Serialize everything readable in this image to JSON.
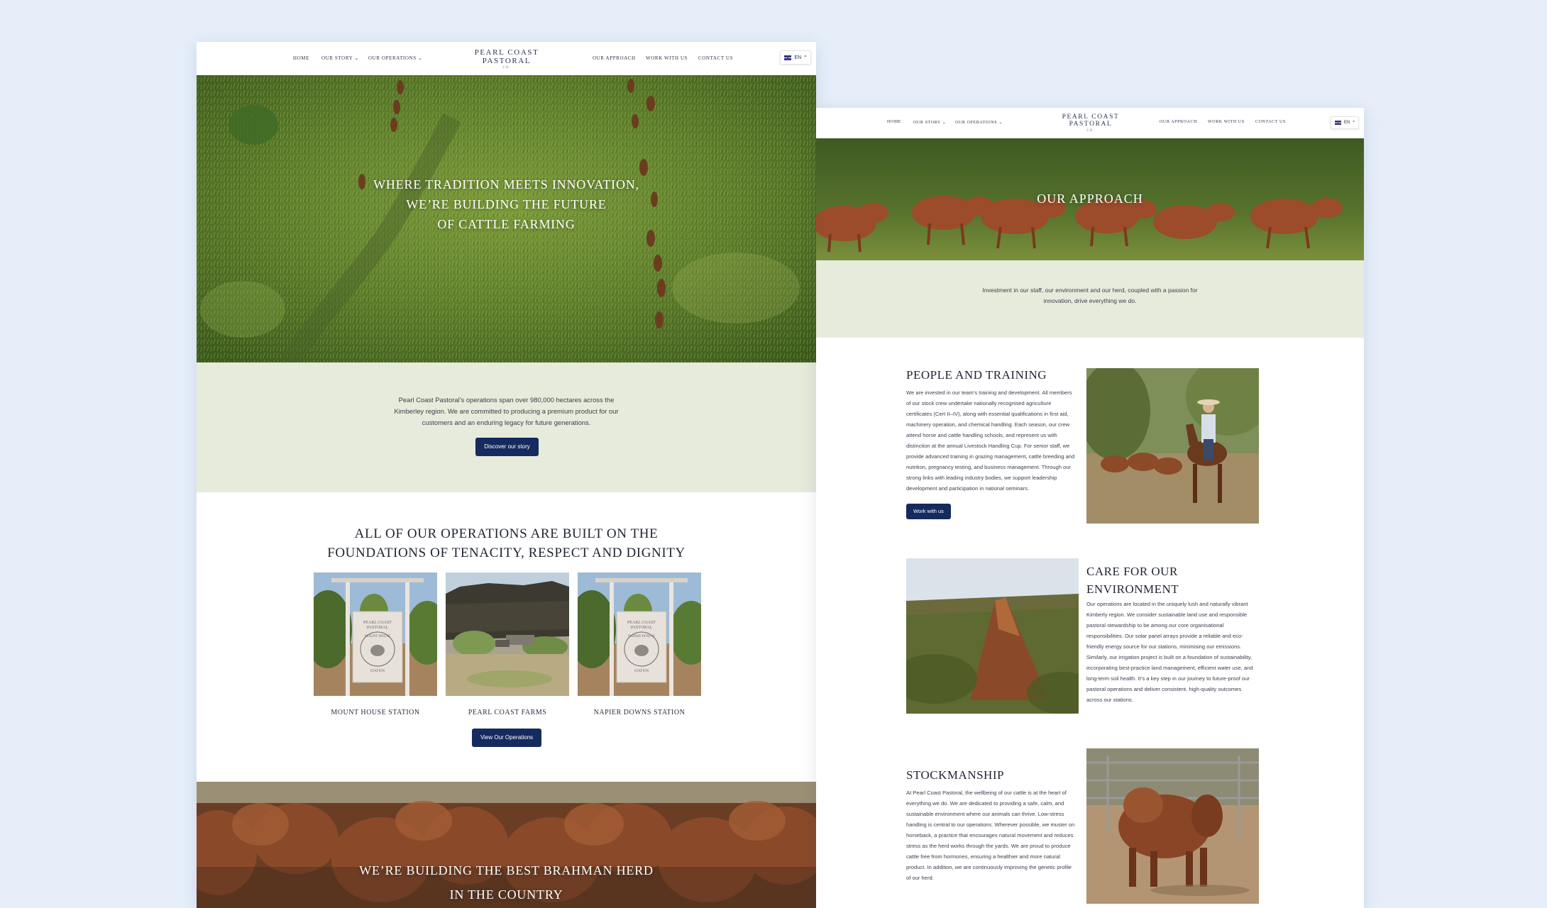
{
  "nav": {
    "home": "HOME",
    "our_story": "OUR STORY",
    "our_operations": "OUR OPERATIONS",
    "our_approach": "OUR APPROACH",
    "work_with_us": "WORK WITH US",
    "contact_us": "CONTACT US",
    "chevron": "⌄",
    "lang_label": "EN",
    "lang_chevron": "^"
  },
  "logo": {
    "line1": "PEARL COAST",
    "line2": "PASTORAL",
    "line3": "CO."
  },
  "home_page": {
    "hero_line1": "WHERE TRADITION MEETS INNOVATION,",
    "hero_line2": "WE’RE BUILDING THE FUTURE",
    "hero_line3": "OF CATTLE FARMING",
    "intro_line1": "Pearl Coast Pastoral’s operations span over 980,000 hectares across the",
    "intro_line2": "Kimberley region.  We are committed to producing a premium product for our",
    "intro_line3": "customers and an enduring legacy for future generations.",
    "discover_button": "Discover our story",
    "ops_heading_line1": "ALL OF OUR OPERATIONS ARE BUILT ON THE",
    "ops_heading_line2": "FOUNDATIONS OF TENACITY, RESPECT AND DIGNITY",
    "operations": [
      {
        "name": "MOUNT HOUSE STATION",
        "sign_line1": "PEARL COAST",
        "sign_line2": "PASTORAL",
        "sign_line3": "MOUNT HOUSE",
        "sign_line4": "STATION"
      },
      {
        "name": "PEARL COAST FARMS"
      },
      {
        "name": "NAPIER DOWNS STATION",
        "sign_line1": "PEARL COAST",
        "sign_line2": "PASTORAL",
        "sign_line3": "NAPIER DOWNS",
        "sign_line4": "STATION"
      }
    ],
    "view_ops_button": "View Our Operations",
    "banner_line1": "WE’RE BUILDING THE BEST BRAHMAN HERD",
    "banner_line2": "IN THE COUNTRY"
  },
  "approach_page": {
    "hero_title": "OUR APPROACH",
    "intro_line1": "Investment in our staff, our environment and our herd, coupled with a passion for",
    "intro_line2": "innovation, drive everything we do.",
    "people": {
      "title": "PEOPLE AND TRAINING",
      "lines": [
        "We are invested in our team’s training and development. All members",
        "of our stock crew undertake nationally recognised agriculture",
        "certificates (Cert II–IV), along with essential qualifications in first aid,",
        "machinery operation, and chemical handling. Each season, our crew",
        "attend horse and cattle handling schools, and represent us with",
        "distinction at the annual Livestock Handling Cup. For senior staff, we",
        "provide advanced training in grazing management, cattle breeding and",
        "nutrition, pregnancy testing, and business management. Through our",
        "strong links with leading industry bodies, we support leadership",
        "development and participation in national seminars."
      ],
      "button": "Work with us"
    },
    "environment": {
      "title_line1": "CARE FOR OUR",
      "title_line2": "ENVIRONMENT",
      "lines": [
        "Our operations are located in the uniquely lush and naturally vibrant",
        "Kimberly region. We consider sustainable land use and responsible",
        "pastoral stewardship to be among our core organisational",
        "responsibilities. Our solar panel arrays provide a reliable and eco-",
        "friendly energy source for our stations, minimising our emissions.",
        "Similarly, our irrigation project is built on a foundation of sustainability,",
        "incorporating best-practice land management, efficient water use, and",
        "long-term soil health. It’s a key step in our journey to future-proof our",
        "pastoral operations and deliver consistent, high-quality outcomes",
        "across our stations."
      ]
    },
    "stockmanship": {
      "title": "STOCKMANSHIP",
      "lines": [
        "At Pearl Coast Pastoral, the wellbeing of our cattle is at the heart of",
        "everything we do. We are dedicated to providing a safe, calm, and",
        "sustainable environment where our animals can thrive. Low-stress",
        "handling is central to our operations. Wherever possible, we muster on",
        "horseback, a practice that encourages natural movement and reduces",
        "stress as the herd works through the yards. We are proud to produce",
        "cattle free from hormones, ensuring a healthier and more natural",
        "product. In addition, we are continuously improving the genetic profile",
        "of our herd."
      ]
    }
  },
  "colors": {
    "background": "#e6eefa",
    "navy_button": "#152a5e",
    "sage_band": "#e6ebdb",
    "text_dark": "#1f2430"
  },
  "icons": [
    "flag-uk-icon",
    "chevron-down-icon"
  ]
}
